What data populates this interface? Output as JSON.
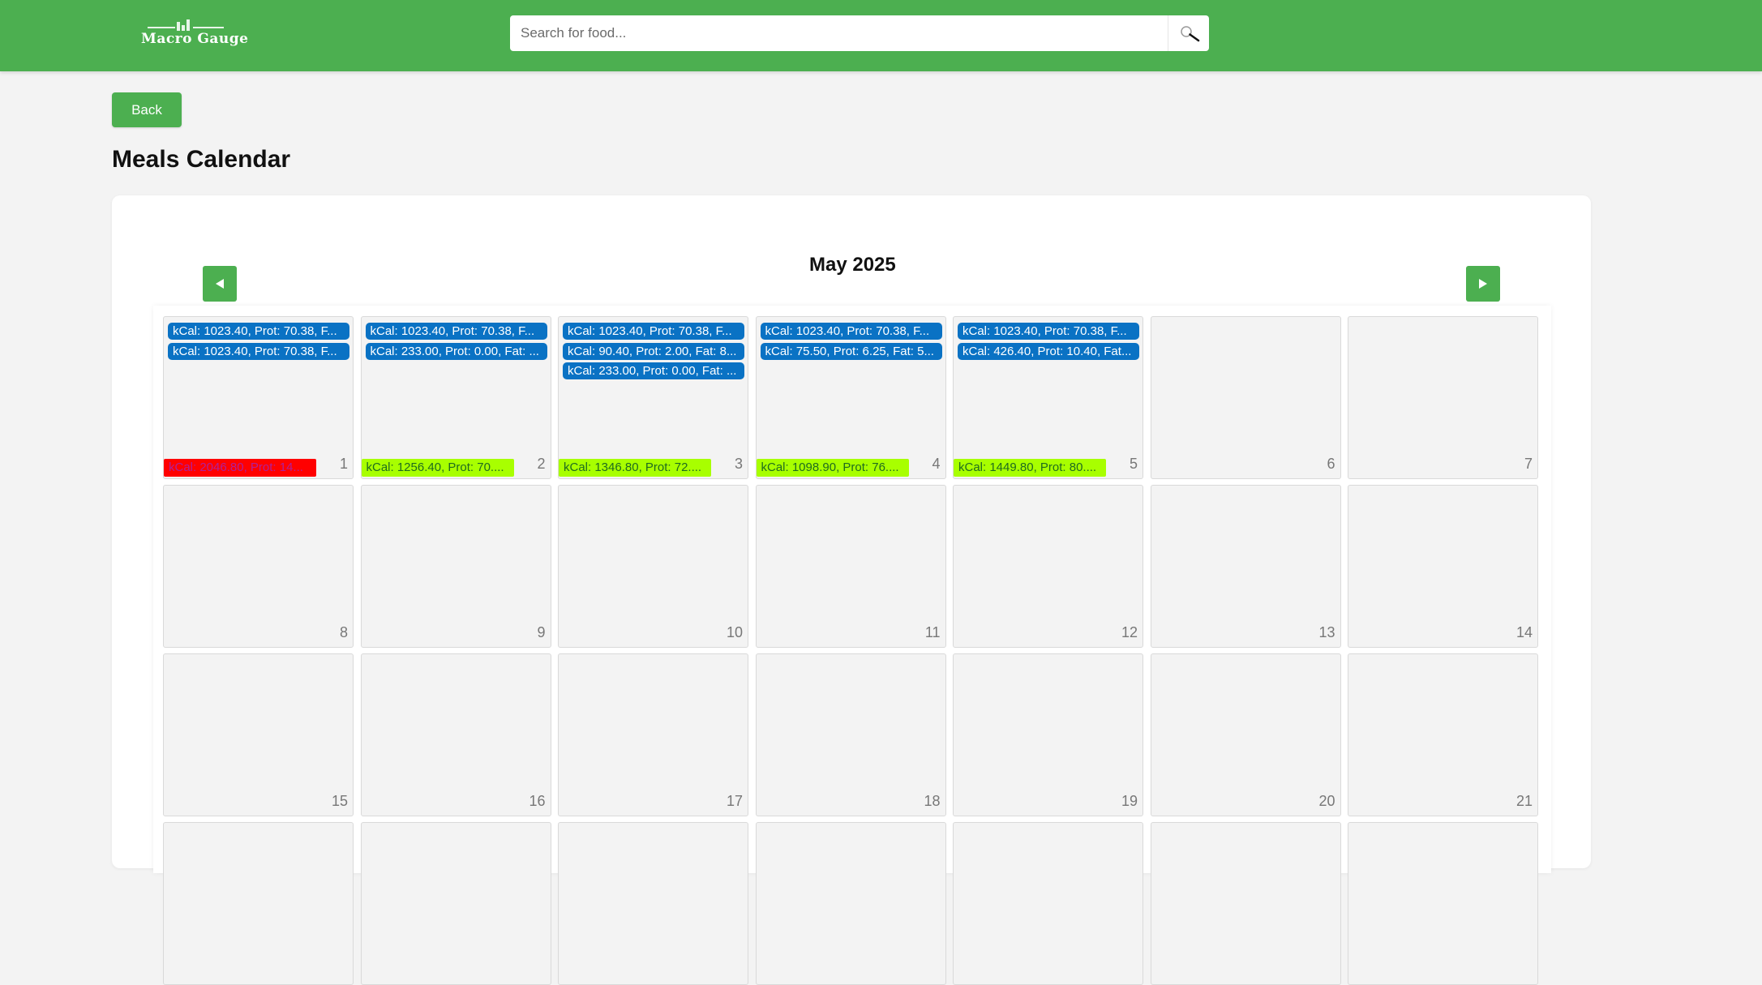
{
  "app": {
    "logo_text": "Macro Gauge"
  },
  "search": {
    "placeholder": "Search for food...",
    "icon": "search-icon"
  },
  "back_label": "Back",
  "page_title": "Meals Calendar",
  "calendar": {
    "month_label": "May 2025",
    "prev_icon": "triangle-left-icon",
    "next_icon": "triangle-right-icon",
    "colors": {
      "header": "#4caf50",
      "meal_chip": "#0a72c4",
      "summary_over": "#ff0000",
      "summary_over_text": "#b0209a",
      "summary_ok": "#a8ff00",
      "summary_ok_text": "#1f6b1f"
    },
    "days": [
      {
        "day": "1",
        "meals": [
          "kCal: 1023.40, Prot: 70.38, F...",
          "kCal: 1023.40, Prot: 70.38, F..."
        ],
        "summary": "kCal: 2046.80, Prot: 14...",
        "summary_status": "over"
      },
      {
        "day": "2",
        "meals": [
          "kCal: 1023.40, Prot: 70.38, F...",
          "kCal: 233.00, Prot: 0.00, Fat: ..."
        ],
        "summary": "kCal: 1256.40, Prot: 70....",
        "summary_status": "ok"
      },
      {
        "day": "3",
        "meals": [
          "kCal: 1023.40, Prot: 70.38, F...",
          "kCal: 90.40, Prot: 2.00, Fat: 8...",
          "kCal: 233.00, Prot: 0.00, Fat: ..."
        ],
        "summary": "kCal: 1346.80, Prot: 72....",
        "summary_status": "ok"
      },
      {
        "day": "4",
        "meals": [
          "kCal: 1023.40, Prot: 70.38, F...",
          "kCal: 75.50, Prot: 6.25, Fat: 5..."
        ],
        "summary": "kCal: 1098.90, Prot: 76....",
        "summary_status": "ok"
      },
      {
        "day": "5",
        "meals": [
          "kCal: 1023.40, Prot: 70.38, F...",
          "kCal: 426.40, Prot: 10.40, Fat..."
        ],
        "summary": "kCal: 1449.80, Prot: 80....",
        "summary_status": "ok"
      },
      {
        "day": "6",
        "meals": [],
        "summary": "",
        "summary_status": ""
      },
      {
        "day": "7",
        "meals": [],
        "summary": "",
        "summary_status": ""
      },
      {
        "day": "8",
        "meals": [],
        "summary": "",
        "summary_status": ""
      },
      {
        "day": "9",
        "meals": [],
        "summary": "",
        "summary_status": ""
      },
      {
        "day": "10",
        "meals": [],
        "summary": "",
        "summary_status": ""
      },
      {
        "day": "11",
        "meals": [],
        "summary": "",
        "summary_status": ""
      },
      {
        "day": "12",
        "meals": [],
        "summary": "",
        "summary_status": ""
      },
      {
        "day": "13",
        "meals": [],
        "summary": "",
        "summary_status": ""
      },
      {
        "day": "14",
        "meals": [],
        "summary": "",
        "summary_status": ""
      },
      {
        "day": "15",
        "meals": [],
        "summary": "",
        "summary_status": ""
      },
      {
        "day": "16",
        "meals": [],
        "summary": "",
        "summary_status": ""
      },
      {
        "day": "17",
        "meals": [],
        "summary": "",
        "summary_status": ""
      },
      {
        "day": "18",
        "meals": [],
        "summary": "",
        "summary_status": ""
      },
      {
        "day": "19",
        "meals": [],
        "summary": "",
        "summary_status": ""
      },
      {
        "day": "20",
        "meals": [],
        "summary": "",
        "summary_status": ""
      },
      {
        "day": "21",
        "meals": [],
        "summary": "",
        "summary_status": ""
      },
      {
        "day": "",
        "meals": [],
        "summary": "",
        "summary_status": ""
      },
      {
        "day": "",
        "meals": [],
        "summary": "",
        "summary_status": ""
      },
      {
        "day": "",
        "meals": [],
        "summary": "",
        "summary_status": ""
      },
      {
        "day": "",
        "meals": [],
        "summary": "",
        "summary_status": ""
      },
      {
        "day": "",
        "meals": [],
        "summary": "",
        "summary_status": ""
      },
      {
        "day": "",
        "meals": [],
        "summary": "",
        "summary_status": ""
      },
      {
        "day": "",
        "meals": [],
        "summary": "",
        "summary_status": ""
      }
    ]
  }
}
